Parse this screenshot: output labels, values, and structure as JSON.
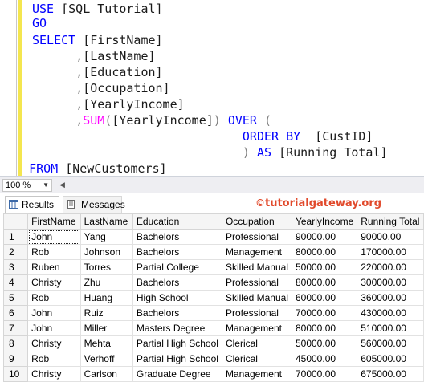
{
  "editor": {
    "lines": [
      [
        {
          "t": "USE ",
          "c": "kw"
        },
        {
          "t": "[SQL Tutorial]",
          "c": "id"
        }
      ],
      [
        {
          "t": "GO",
          "c": "kw"
        }
      ],
      [
        {
          "t": "SELECT ",
          "c": "kw"
        },
        {
          "t": "[FirstName]",
          "c": "id"
        }
      ],
      [
        {
          "t": "      ",
          "c": "id"
        },
        {
          "t": ",",
          "c": "gray"
        },
        {
          "t": "[LastName]",
          "c": "id"
        }
      ],
      [
        {
          "t": "      ",
          "c": "id"
        },
        {
          "t": ",",
          "c": "gray"
        },
        {
          "t": "[Education]",
          "c": "id"
        }
      ],
      [
        {
          "t": "      ",
          "c": "id"
        },
        {
          "t": ",",
          "c": "gray"
        },
        {
          "t": "[Occupation]",
          "c": "id"
        }
      ],
      [
        {
          "t": "      ",
          "c": "id"
        },
        {
          "t": ",",
          "c": "gray"
        },
        {
          "t": "[YearlyIncome]",
          "c": "id"
        }
      ],
      [
        {
          "t": "      ",
          "c": "id"
        },
        {
          "t": ",",
          "c": "gray"
        },
        {
          "t": "SUM",
          "c": "fn"
        },
        {
          "t": "(",
          "c": "gray"
        },
        {
          "t": "[YearlyIncome]",
          "c": "id"
        },
        {
          "t": ")",
          "c": "gray"
        },
        {
          "t": " OVER ",
          "c": "kw"
        },
        {
          "t": "(",
          "c": "gray"
        }
      ],
      [
        {
          "t": "                             ",
          "c": "id"
        },
        {
          "t": "ORDER BY",
          "c": "kw"
        },
        {
          "t": "  [CustID]",
          "c": "id"
        }
      ],
      [
        {
          "t": "                             ",
          "c": "id"
        },
        {
          "t": ")",
          "c": "gray"
        },
        {
          "t": " AS ",
          "c": "kw"
        },
        {
          "t": "[Running Total]",
          "c": "id"
        }
      ],
      [
        {
          "t": "  ",
          "c": "id"
        },
        {
          "t": "FROM ",
          "c": "kw"
        },
        {
          "t": "[NewCustomers]",
          "c": "id"
        }
      ]
    ]
  },
  "zoom": {
    "value": "100 %"
  },
  "tabs": {
    "results_label": "Results",
    "messages_label": "Messages"
  },
  "watermark": {
    "symbol": "©",
    "text": "tutorialgateway.org",
    "color": "#e1492b"
  },
  "grid": {
    "columns": [
      "FirstName",
      "LastName",
      "Education",
      "Occupation",
      "YearlyIncome",
      "Running Total"
    ],
    "rows": [
      [
        "1",
        "John",
        "Yang",
        "Bachelors",
        "Professional",
        "90000.00",
        "90000.00"
      ],
      [
        "2",
        "Rob",
        "Johnson",
        "Bachelors",
        "Management",
        "80000.00",
        "170000.00"
      ],
      [
        "3",
        "Ruben",
        "Torres",
        "Partial College",
        "Skilled Manual",
        "50000.00",
        "220000.00"
      ],
      [
        "4",
        "Christy",
        "Zhu",
        "Bachelors",
        "Professional",
        "80000.00",
        "300000.00"
      ],
      [
        "5",
        "Rob",
        "Huang",
        "High School",
        "Skilled Manual",
        "60000.00",
        "360000.00"
      ],
      [
        "6",
        "John",
        "Ruiz",
        "Bachelors",
        "Professional",
        "70000.00",
        "430000.00"
      ],
      [
        "7",
        "John",
        "Miller",
        "Masters Degree",
        "Management",
        "80000.00",
        "510000.00"
      ],
      [
        "8",
        "Christy",
        "Mehta",
        "Partial High School",
        "Clerical",
        "50000.00",
        "560000.00"
      ],
      [
        "9",
        "Rob",
        "Verhoff",
        "Partial High School",
        "Clerical",
        "45000.00",
        "605000.00"
      ],
      [
        "10",
        "Christy",
        "Carlson",
        "Graduate Degree",
        "Management",
        "70000.00",
        "675000.00"
      ]
    ]
  }
}
